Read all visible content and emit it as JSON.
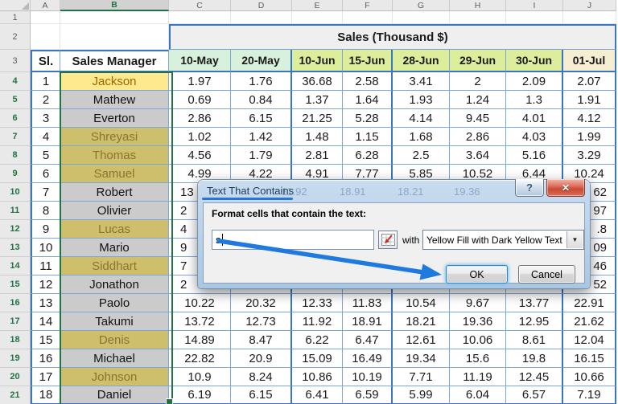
{
  "sheet": {
    "column_letters": [
      "A",
      "B",
      "C",
      "D",
      "E",
      "F",
      "G",
      "H",
      "I",
      "J"
    ],
    "selected_column": "B",
    "row_numbers_top": [
      "1",
      "2",
      "3"
    ],
    "title": "Sales (Thousand $)",
    "headers": {
      "sl": "Sl.",
      "manager": "Sales Manager",
      "dates": [
        "10-May",
        "20-May",
        "10-Jun",
        "15-Jun",
        "28-Jun",
        "29-Jun",
        "30-Jun",
        "01-Jul"
      ]
    },
    "rows": [
      {
        "row": "4",
        "sl": "1",
        "name": "Jackson",
        "style": "yellow-active",
        "occluded": false,
        "values": [
          "1.97",
          "1.76",
          "36.68",
          "2.58",
          "3.41",
          "2",
          "2.09",
          "2.07"
        ]
      },
      {
        "row": "5",
        "sl": "2",
        "name": "Mathew",
        "style": "plain-selected",
        "occluded": false,
        "values": [
          "0.69",
          "0.84",
          "1.37",
          "1.64",
          "1.93",
          "1.24",
          "1.3",
          "1.91"
        ]
      },
      {
        "row": "6",
        "sl": "3",
        "name": "Everton",
        "style": "plain-selected",
        "occluded": false,
        "values": [
          "2.86",
          "6.15",
          "21.25",
          "5.28",
          "4.14",
          "9.45",
          "4.01",
          "4.12"
        ]
      },
      {
        "row": "7",
        "sl": "4",
        "name": "Shreyasi",
        "style": "yellow-selected",
        "occluded": false,
        "values": [
          "1.02",
          "1.42",
          "1.48",
          "1.15",
          "1.68",
          "2.86",
          "4.03",
          "1.99"
        ]
      },
      {
        "row": "8",
        "sl": "5",
        "name": "Thomas",
        "style": "yellow-selected",
        "occluded": false,
        "values": [
          "4.56",
          "1.79",
          "2.81",
          "6.28",
          "2.5",
          "3.64",
          "5.16",
          "3.29"
        ]
      },
      {
        "row": "9",
        "sl": "6",
        "name": "Samuel",
        "style": "yellow-selected",
        "occluded": false,
        "values": [
          "4.99",
          "4.22",
          "4.91",
          "7.77",
          "5.85",
          "10.52",
          "6.44",
          "10.24"
        ]
      },
      {
        "row": "10",
        "sl": "7",
        "name": "Robert",
        "style": "plain-selected",
        "occluded": true,
        "values": [
          "13",
          "",
          "",
          "",
          "",
          "",
          "",
          "62"
        ]
      },
      {
        "row": "11",
        "sl": "8",
        "name": "Olivier",
        "style": "plain-selected",
        "occluded": true,
        "values": [
          "2",
          "",
          "",
          "",
          "",
          "",
          "",
          "97"
        ]
      },
      {
        "row": "12",
        "sl": "9",
        "name": "Lucas",
        "style": "yellow-selected",
        "occluded": true,
        "values": [
          "4",
          "",
          "",
          "",
          "",
          "",
          "",
          ".8"
        ]
      },
      {
        "row": "13",
        "sl": "10",
        "name": "Mario",
        "style": "plain-selected",
        "occluded": true,
        "values": [
          "9",
          "",
          "",
          "",
          "",
          "",
          "",
          "09"
        ]
      },
      {
        "row": "14",
        "sl": "11",
        "name": "Siddhart",
        "style": "yellow-selected",
        "occluded": true,
        "values": [
          "7",
          "",
          "",
          "",
          "",
          "",
          "",
          "46"
        ]
      },
      {
        "row": "15",
        "sl": "12",
        "name": "Jonathon",
        "style": "plain-selected",
        "occluded": true,
        "values": [
          "2",
          "",
          "",
          "",
          "",
          "",
          "",
          "52"
        ]
      },
      {
        "row": "16",
        "sl": "13",
        "name": "Paolo",
        "style": "plain-selected",
        "occluded": false,
        "values": [
          "10.22",
          "20.32",
          "12.33",
          "11.83",
          "10.54",
          "9.67",
          "13.77",
          "22.91"
        ]
      },
      {
        "row": "17",
        "sl": "14",
        "name": "Takumi",
        "style": "plain-selected",
        "occluded": false,
        "values": [
          "13.72",
          "12.73",
          "11.92",
          "18.91",
          "18.21",
          "19.36",
          "12.95",
          "21.62"
        ]
      },
      {
        "row": "18",
        "sl": "15",
        "name": "Denis",
        "style": "yellow-selected",
        "occluded": false,
        "values": [
          "14.89",
          "8.47",
          "6.22",
          "6.47",
          "12.61",
          "10.06",
          "8.61",
          "12.04"
        ]
      },
      {
        "row": "19",
        "sl": "16",
        "name": "Michael",
        "style": "plain-selected",
        "occluded": false,
        "values": [
          "22.82",
          "20.9",
          "15.09",
          "16.49",
          "19.34",
          "15.6",
          "19.8",
          "16.15"
        ]
      },
      {
        "row": "20",
        "sl": "17",
        "name": "Johnson",
        "style": "yellow-selected",
        "occluded": false,
        "values": [
          "10.9",
          "8.24",
          "10.86",
          "10.19",
          "7.71",
          "11.19",
          "12.45",
          "10.66"
        ]
      },
      {
        "row": "21",
        "sl": "18",
        "name": "Daniel",
        "style": "plain-selected",
        "occluded": false,
        "values": [
          "6.19",
          "6.15",
          "6.41",
          "6.59",
          "5.99",
          "6.04",
          "6.57",
          "7.19"
        ]
      }
    ]
  },
  "dialog": {
    "title": "Text That Contains",
    "help_glyph": "?",
    "close_glyph": "✕",
    "label": "Format cells that contain the text:",
    "input_value": "s",
    "with_label": "with",
    "format_option": "Yellow Fill with Dark Yellow Text",
    "dropdown_glyph": "▼",
    "ok_label": "OK",
    "cancel_label": "Cancel",
    "ghost_values": [
      "11.92",
      "18.91",
      "18.21",
      "19.36"
    ]
  },
  "colors": {
    "accent_green": "#217346",
    "grid_blue_thin": "#7da7d8",
    "grid_blue_thick": "#3a75c4",
    "yellow_fill": "#ffe98f",
    "dark_yellow_text": "#9c6500",
    "may_header_fill": "#d8f1dd",
    "jun_header_fill": "#dcee9b",
    "jul_header_fill": "#f6eed3",
    "arrow_blue": "#1f7ae0"
  }
}
